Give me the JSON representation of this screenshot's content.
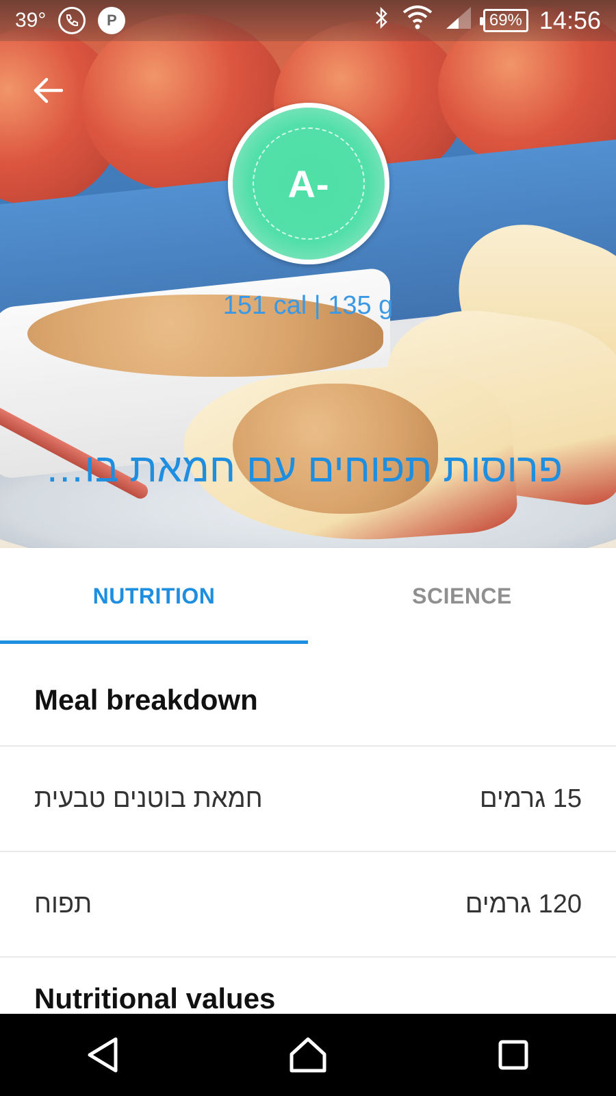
{
  "status_bar": {
    "temperature": "39°",
    "battery": "69%",
    "time": "14:56",
    "icons": [
      "missed-call-icon",
      "parking-icon",
      "bluetooth-icon",
      "wifi-icon",
      "signal-icon",
      "battery-icon"
    ]
  },
  "hero": {
    "grade": "A-",
    "calories_weight": "151 cal | 135 g",
    "meal_name": "פרוסות תפוחים עם חמאת בוטנים"
  },
  "tabs": [
    {
      "label": "NUTRITION",
      "active": true
    },
    {
      "label": "SCIENCE",
      "active": false
    }
  ],
  "breakdown": {
    "title": "Meal breakdown",
    "items": [
      {
        "name": "חמאת בוטנים טבעית",
        "amount": "15 גרמים"
      },
      {
        "name": "תפוח",
        "amount": "120 גרמים"
      }
    ]
  },
  "nutritional": {
    "title": "Nutritional values"
  },
  "colors": {
    "accent": "#1e8ee0",
    "grade": "#4fe1a6"
  }
}
